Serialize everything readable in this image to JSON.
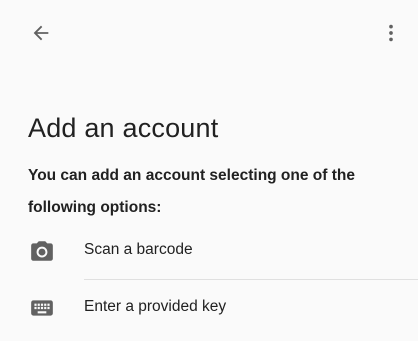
{
  "toolbar": {
    "back_icon": "arrow-back-icon",
    "menu_icon": "more-vert-icon"
  },
  "page": {
    "title": "Add an account",
    "subtitle": "You can add an account selecting one of the following options:"
  },
  "options": [
    {
      "label": "Scan a barcode",
      "icon": "camera-icon"
    },
    {
      "label": "Enter a provided key",
      "icon": "keyboard-icon"
    }
  ],
  "colors": {
    "background": "#fafafa",
    "icon": "#616161",
    "text": "#212121",
    "divider": "#e0e0e0"
  }
}
